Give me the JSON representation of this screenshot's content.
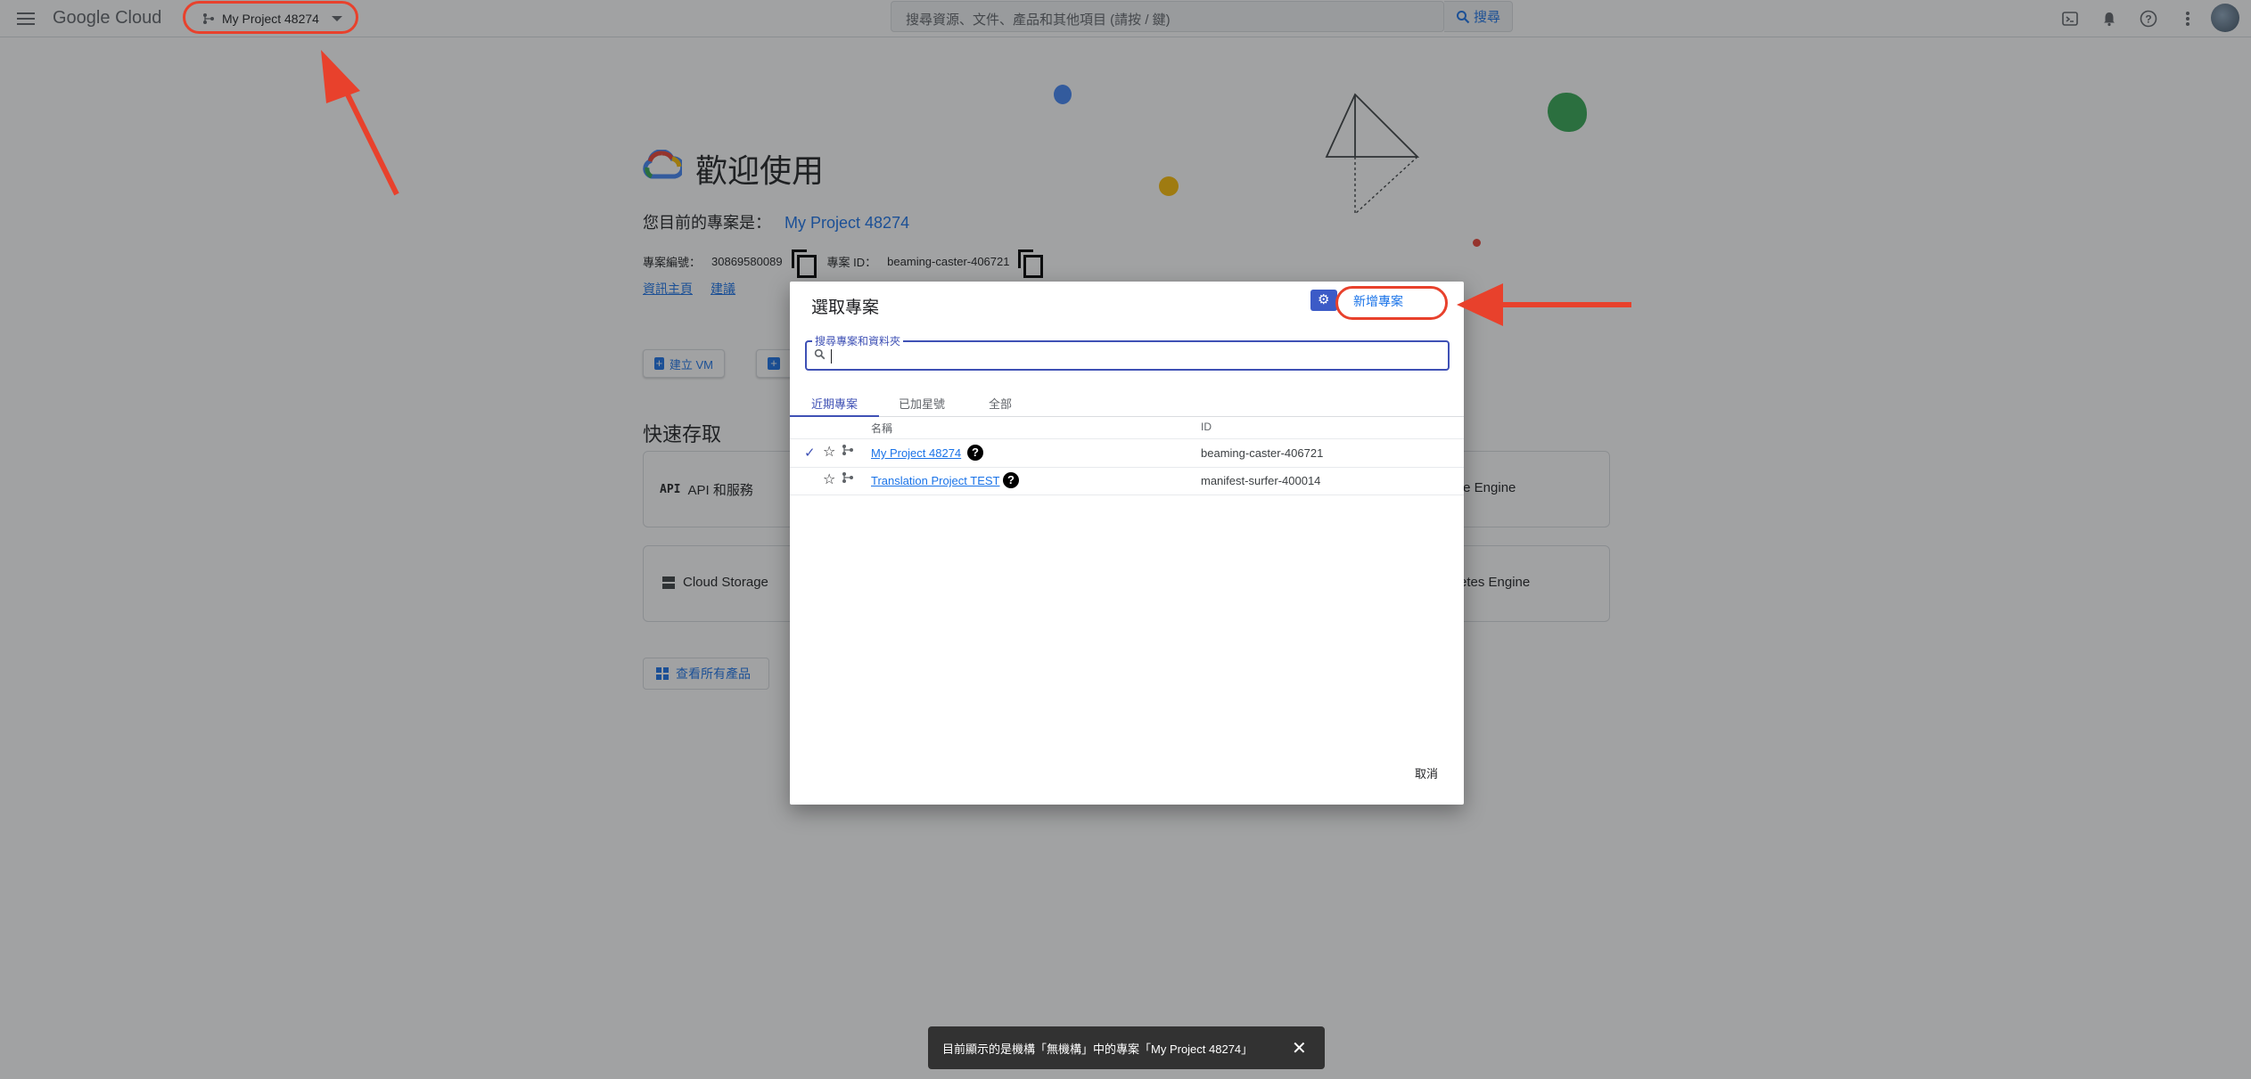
{
  "topbar": {
    "brand_google": "Google",
    "brand_cloud": "Cloud",
    "project_selector": "My Project 48274",
    "search_placeholder": "搜尋資源、文件、產品和其他項目 (請按 / 鍵)",
    "search_button": "搜尋",
    "icons": [
      "menu-icon",
      "project-tree-icon",
      "chevron-down-icon",
      "search-icon",
      "terminal-icon",
      "bell-icon",
      "help-icon",
      "more-vert-icon",
      "avatar"
    ]
  },
  "welcome": {
    "title": "歡迎使用",
    "current_project_label": "您目前的專案是：",
    "current_project_name": "My Project 48274",
    "project_number_label": "專案編號：",
    "project_number": "30869580089",
    "project_id_label": "專案 ID：",
    "project_id": "beaming-caster-406721",
    "link_dashboard": "資訊主頁",
    "link_recommendations": "建議",
    "create_vm": "建立 VM",
    "quick_access_title": "快速存取",
    "cards": [
      {
        "label": "API 和服務",
        "icon": "API"
      },
      {
        "label": "Cloud Storage",
        "icon": "storage-icon"
      },
      {
        "label": "te Engine"
      },
      {
        "label": "etes Engine"
      }
    ],
    "view_all_products": "查看所有產品"
  },
  "dialog": {
    "title": "選取專案",
    "new_project": "新增專案",
    "search_label": "搜尋專案和資料夾",
    "tabs": [
      "近期專案",
      "已加星號",
      "全部"
    ],
    "active_tab": 0,
    "col_name": "名稱",
    "col_id": "ID",
    "rows": [
      {
        "name": "My Project 48274",
        "id": "beaming-caster-406721",
        "selected": true
      },
      {
        "name": "Translation Project TEST",
        "id": "manifest-surfer-400014",
        "selected": false
      }
    ],
    "cancel": "取消"
  },
  "snackbar": {
    "message": "目前顯示的是機構「無機構」中的專案「My Project 48274」"
  },
  "colors": {
    "annotation_red": "#e8412c",
    "accent_blue": "#1a73e8",
    "dialog_indigo": "#3f51b5"
  }
}
